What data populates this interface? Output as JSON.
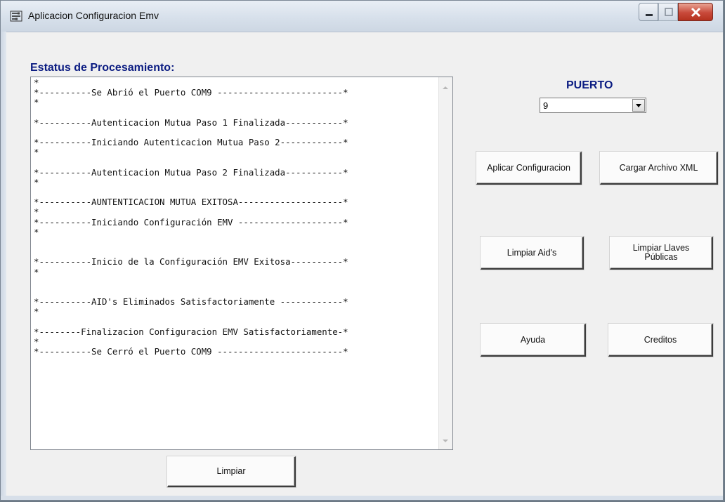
{
  "window": {
    "title": "Aplicacion Configuracion Emv",
    "icon": "settings-app-icon"
  },
  "status": {
    "label": "Estatus de Procesamiento:",
    "log_lines": [
      "*",
      "*----------Se Abrió el Puerto COM9 ------------------------*",
      "*",
      "",
      "*----------Autenticacion Mutua Paso 1 Finalizada-----------*",
      "",
      "*----------Iniciando Autenticacion Mutua Paso 2------------*",
      "*",
      "",
      "*----------Autenticacion Mutua Paso 2 Finalizada-----------*",
      "*",
      "",
      "*----------AUNTENTICACION MUTUA EXITOSA--------------------*",
      "*",
      "*----------Iniciando Configuración EMV --------------------*",
      "*",
      "",
      "",
      "*----------Inicio de la Configuración EMV Exitosa----------*",
      "*",
      "",
      "",
      "*----------AID's Eliminados Satisfactoriamente ------------*",
      "*",
      "",
      "*--------Finalizacion Configuracion EMV Satisfactoriamente-*",
      "*",
      "*----------Se Cerró el Puerto COM9 ------------------------*"
    ]
  },
  "port": {
    "label": "PUERTO",
    "selected": "9"
  },
  "buttons": {
    "aplicar": "Aplicar Configuracion",
    "cargar": "Cargar Archivo XML",
    "limpiar_aid": "Limpiar Aid's",
    "limpiar_llaves": "Limpiar Llaves\nPúblicas",
    "ayuda": "Ayuda",
    "creditos": "Creditos",
    "limpiar": "Limpiar"
  }
}
